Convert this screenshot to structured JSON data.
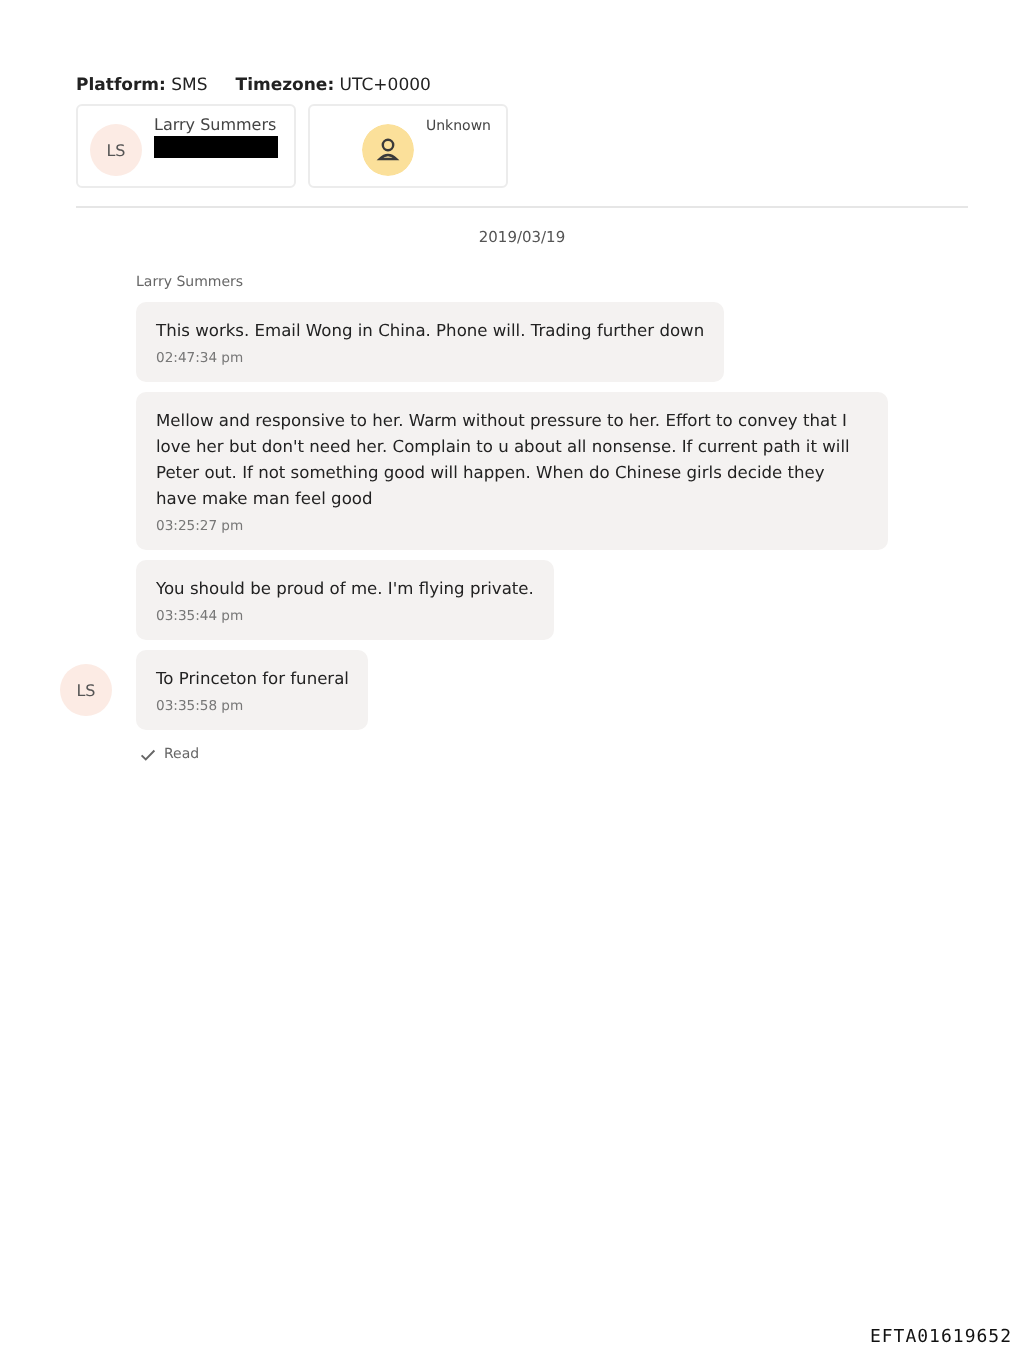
{
  "header": {
    "platform_label": "Platform:",
    "platform": "SMS",
    "timezone_label": "Timezone:",
    "timezone": "UTC+0000"
  },
  "participants": [
    {
      "kind": "initials",
      "initials": "LS",
      "name": "Larry Summers",
      "redacted": true
    },
    {
      "kind": "icon",
      "name": "Unknown",
      "redacted": false
    }
  ],
  "date": "2019/03/19",
  "sender": "Larry Summers",
  "messages": [
    {
      "text": "This works. Email Wong in China. Phone will. Trading further down",
      "time": "02:47:34 pm"
    },
    {
      "text": "Mellow and responsive to her. Warm without pressure to her. Effort to convey that I love her but don't need her. Complain to u about all nonsense. If current path it will Peter out. If not something good will happen. When do Chinese girls decide they have make man feel good",
      "time": "03:25:27 pm"
    },
    {
      "text": "You should be proud of me. I'm flying private.",
      "time": "03:35:44 pm"
    },
    {
      "text": "To Princeton for funeral",
      "time": "03:35:58 pm",
      "avatar": "LS"
    }
  ],
  "status": "Read",
  "page_id": "EFTA01619652"
}
